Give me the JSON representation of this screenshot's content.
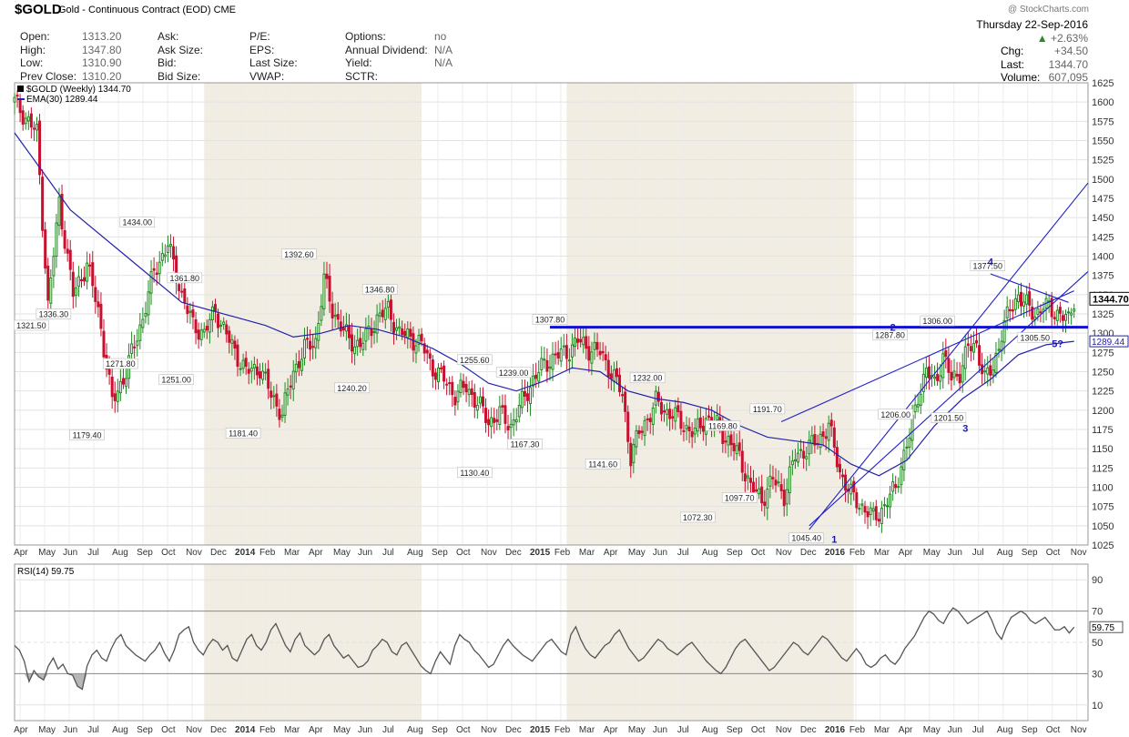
{
  "header": {
    "ticker": "$GOLD",
    "subtitle": "Gold - Continuous Contract (EOD)  CME",
    "credit": "@ StockCharts.com",
    "date": "Thursday  22-Sep-2016",
    "change_pct": "+2.63%",
    "chg_label": "Chg:",
    "chg_value": "+34.50",
    "last_label": "Last:",
    "last_value": "1344.70",
    "volume_label": "Volume:",
    "volume_value": "607,095"
  },
  "quote": {
    "col1": [
      {
        "label": "Open:",
        "value": "1313.20"
      },
      {
        "label": "High:",
        "value": "1347.80"
      },
      {
        "label": "Low:",
        "value": "1310.90"
      },
      {
        "label": "Prev Close:",
        "value": "1310.20"
      }
    ],
    "col2": [
      {
        "label": "Ask:",
        "value": ""
      },
      {
        "label": "Ask Size:",
        "value": ""
      },
      {
        "label": "Bid:",
        "value": ""
      },
      {
        "label": "Bid Size:",
        "value": ""
      }
    ],
    "col3": [
      {
        "label": "P/E:",
        "value": ""
      },
      {
        "label": "EPS:",
        "value": ""
      },
      {
        "label": "Last Size:",
        "value": ""
      },
      {
        "label": "VWAP:",
        "value": ""
      }
    ],
    "col4": [
      {
        "label": "Options:",
        "value": "no"
      },
      {
        "label": "Annual Dividend:",
        "value": "N/A"
      },
      {
        "label": "Yield:",
        "value": "N/A"
      },
      {
        "label": "SCTR:",
        "value": ""
      }
    ]
  },
  "chart_data": [
    {
      "type": "candlestick",
      "legend": [
        "$GOLD (Weekly) 1344.70",
        "EMA(30) 1289.44"
      ],
      "ylim": [
        1025,
        1625
      ],
      "y_ticks": [
        1025,
        1050,
        1075,
        1100,
        1125,
        1150,
        1175,
        1200,
        1225,
        1250,
        1275,
        1300,
        1325,
        1350,
        1375,
        1400,
        1425,
        1450,
        1475,
        1500,
        1525,
        1550,
        1575,
        1600,
        1625
      ],
      "x_labels": [
        "Apr",
        "May",
        "Jun",
        "Jul",
        "Aug",
        "Sep",
        "Oct",
        "Nov",
        "Dec",
        "2014",
        "Feb",
        "Mar",
        "Apr",
        "May",
        "Jun",
        "Jul",
        "Aug",
        "Sep",
        "Oct",
        "Nov",
        "Dec",
        "2015",
        "Feb",
        "Mar",
        "Apr",
        "May",
        "Jun",
        "Jul",
        "Aug",
        "Sep",
        "Oct",
        "Nov",
        "Dec",
        "2016",
        "Feb",
        "Mar",
        "Apr",
        "May",
        "Jun",
        "Jul",
        "Aug",
        "Sep",
        "Oct",
        "Nov"
      ],
      "price_path": [
        [
          0,
          1600
        ],
        [
          8,
          1560
        ],
        [
          12,
          1335
        ],
        [
          16,
          1470
        ],
        [
          21,
          1350
        ],
        [
          26,
          1390
        ],
        [
          30,
          1330
        ],
        [
          35,
          1210
        ],
        [
          40,
          1250
        ],
        [
          46,
          1320
        ],
        [
          50,
          1380
        ],
        [
          55,
          1415
        ],
        [
          60,
          1350
        ],
        [
          64,
          1310
        ],
        [
          68,
          1300
        ],
        [
          72,
          1330
        ],
        [
          77,
          1290
        ],
        [
          83,
          1250
        ],
        [
          88,
          1255
        ],
        [
          92,
          1220
        ],
        [
          96,
          1195
        ],
        [
          100,
          1250
        ],
        [
          104,
          1280
        ],
        [
          108,
          1290
        ],
        [
          111,
          1370
        ],
        [
          114,
          1330
        ],
        [
          117,
          1310
        ],
        [
          120,
          1290
        ],
        [
          124,
          1285
        ],
        [
          127,
          1300
        ],
        [
          130,
          1320
        ],
        [
          134,
          1330
        ],
        [
          138,
          1300
        ],
        [
          142,
          1295
        ],
        [
          146,
          1285
        ],
        [
          150,
          1255
        ],
        [
          154,
          1240
        ],
        [
          158,
          1220
        ],
        [
          162,
          1230
        ],
        [
          166,
          1210
        ],
        [
          170,
          1185
        ],
        [
          174,
          1195
        ],
        [
          178,
          1180
        ],
        [
          182,
          1210
        ],
        [
          186,
          1240
        ],
        [
          190,
          1260
        ],
        [
          194,
          1270
        ],
        [
          198,
          1275
        ],
        [
          202,
          1290
        ],
        [
          206,
          1280
        ],
        [
          210,
          1275
        ],
        [
          214,
          1250
        ],
        [
          218,
          1220
        ],
        [
          221,
          1140
        ],
        [
          224,
          1170
        ],
        [
          227,
          1190
        ],
        [
          230,
          1210
        ],
        [
          233,
          1200
        ],
        [
          236,
          1195
        ],
        [
          240,
          1180
        ],
        [
          244,
          1170
        ],
        [
          248,
          1190
        ],
        [
          252,
          1180
        ],
        [
          256,
          1160
        ],
        [
          260,
          1140
        ],
        [
          264,
          1100
        ],
        [
          268,
          1085
        ],
        [
          272,
          1110
        ],
        [
          276,
          1090
        ],
        [
          280,
          1140
        ],
        [
          284,
          1150
        ],
        [
          288,
          1160
        ],
        [
          292,
          1180
        ],
        [
          296,
          1120
        ],
        [
          300,
          1090
        ],
        [
          304,
          1075
        ],
        [
          308,
          1060
        ],
        [
          312,
          1075
        ],
        [
          316,
          1100
        ],
        [
          318,
          1130
        ],
        [
          321,
          1165
        ],
        [
          324,
          1220
        ],
        [
          327,
          1250
        ],
        [
          330,
          1235
        ],
        [
          333,
          1270
        ],
        [
          336,
          1240
        ],
        [
          339,
          1250
        ],
        [
          342,
          1280
        ],
        [
          345,
          1285
        ],
        [
          348,
          1240
        ],
        [
          351,
          1255
        ],
        [
          354,
          1300
        ],
        [
          357,
          1330
        ],
        [
          360,
          1350
        ],
        [
          363,
          1335
        ],
        [
          366,
          1325
        ],
        [
          369,
          1335
        ],
        [
          372,
          1330
        ],
        [
          375,
          1325
        ],
        [
          378,
          1315
        ],
        [
          380,
          1345
        ]
      ],
      "ema_path": [
        [
          0,
          1560
        ],
        [
          20,
          1460
        ],
        [
          40,
          1400
        ],
        [
          60,
          1340
        ],
        [
          80,
          1320
        ],
        [
          90,
          1310
        ],
        [
          100,
          1295
        ],
        [
          110,
          1300
        ],
        [
          120,
          1310
        ],
        [
          130,
          1305
        ],
        [
          140,
          1295
        ],
        [
          150,
          1280
        ],
        [
          160,
          1260
        ],
        [
          170,
          1235
        ],
        [
          180,
          1225
        ],
        [
          190,
          1238
        ],
        [
          200,
          1255
        ],
        [
          210,
          1250
        ],
        [
          220,
          1225
        ],
        [
          230,
          1215
        ],
        [
          240,
          1210
        ],
        [
          250,
          1200
        ],
        [
          260,
          1180
        ],
        [
          270,
          1165
        ],
        [
          280,
          1160
        ],
        [
          290,
          1155
        ],
        [
          300,
          1130
        ],
        [
          310,
          1115
        ],
        [
          320,
          1135
        ],
        [
          330,
          1180
        ],
        [
          340,
          1215
        ],
        [
          350,
          1240
        ],
        [
          360,
          1272
        ],
        [
          370,
          1285
        ],
        [
          380,
          1289.44
        ]
      ],
      "last_price": 1344.7,
      "ema_last": 1289.44,
      "horizontal_line": 1307.8,
      "price_labels": [
        {
          "text": "1321.50",
          "w": 6,
          "y": 1321.5,
          "pos": "below"
        },
        {
          "text": "1336.30",
          "w": 14,
          "y": 1336.3,
          "pos": "below"
        },
        {
          "text": "1179.40",
          "w": 26,
          "y": 1179.4,
          "pos": "below"
        },
        {
          "text": "1271.80",
          "w": 38,
          "y": 1271.8,
          "pos": "below"
        },
        {
          "text": "1434.00",
          "w": 44,
          "y": 1434,
          "pos": "above"
        },
        {
          "text": "1361.80",
          "w": 61,
          "y": 1361.8,
          "pos": "above"
        },
        {
          "text": "1251.00",
          "w": 58,
          "y": 1251,
          "pos": "below"
        },
        {
          "text": "1181.40",
          "w": 82,
          "y": 1181.4,
          "pos": "below"
        },
        {
          "text": "1392.60",
          "w": 102,
          "y": 1392.6,
          "pos": "above"
        },
        {
          "text": "1346.80",
          "w": 131,
          "y": 1346.8,
          "pos": "above"
        },
        {
          "text": "1240.20",
          "w": 121,
          "y": 1240.2,
          "pos": "below"
        },
        {
          "text": "1255.60",
          "w": 165,
          "y": 1255.6,
          "pos": "above"
        },
        {
          "text": "1239.00",
          "w": 179,
          "y": 1239,
          "pos": "above"
        },
        {
          "text": "1130.40",
          "w": 165,
          "y": 1130.4,
          "pos": "below"
        },
        {
          "text": "1167.30",
          "w": 183,
          "y": 1167.3,
          "pos": "below"
        },
        {
          "text": "1307.80",
          "w": 192,
          "y": 1307.8,
          "pos": "above"
        },
        {
          "text": "1141.60",
          "w": 211,
          "y": 1141.6,
          "pos": "below"
        },
        {
          "text": "1232.00",
          "w": 227,
          "y": 1232,
          "pos": "above"
        },
        {
          "text": "1169.80",
          "w": 254,
          "y": 1169.8,
          "pos": "above"
        },
        {
          "text": "1191.70",
          "w": 270,
          "y": 1191.7,
          "pos": "above"
        },
        {
          "text": "1072.30",
          "w": 245,
          "y": 1072.3,
          "pos": "below"
        },
        {
          "text": "1097.70",
          "w": 260,
          "y": 1097.7,
          "pos": "below"
        },
        {
          "text": "1045.40",
          "w": 284,
          "y": 1045.4,
          "pos": "below"
        },
        {
          "text": "1287.80",
          "w": 314,
          "y": 1287.8,
          "pos": "above"
        },
        {
          "text": "1306.00",
          "w": 331,
          "y": 1306,
          "pos": "above"
        },
        {
          "text": "1206.00",
          "w": 316,
          "y": 1206,
          "pos": "below"
        },
        {
          "text": "1201.50",
          "w": 335,
          "y": 1201.5,
          "pos": "below"
        },
        {
          "text": "1377.50",
          "w": 349,
          "y": 1377.5,
          "pos": "above"
        },
        {
          "text": "1305.50",
          "w": 366,
          "y": 1305.5,
          "pos": "below"
        }
      ],
      "wave_labels": [
        {
          "text": "1",
          "w": 293,
          "y": 1028
        },
        {
          "text": "2",
          "w": 314,
          "y": 1303
        },
        {
          "text": "3",
          "w": 340,
          "y": 1172
        },
        {
          "text": "4",
          "w": 349,
          "y": 1388
        },
        {
          "text": "5?",
          "w": 372,
          "y": 1282
        }
      ],
      "trend_lines": [
        [
          [
            285,
            1045
          ],
          [
            385,
            1495
          ]
        ],
        [
          [
            275,
            1185
          ],
          [
            380,
            1355
          ]
        ],
        [
          [
            285,
            1050
          ],
          [
            385,
            1380
          ]
        ],
        [
          [
            350,
            1377
          ],
          [
            378,
            1340
          ]
        ]
      ]
    },
    {
      "type": "line",
      "legend": [
        "RSI(14) 59.75"
      ],
      "ylim": [
        0,
        100
      ],
      "y_ticks": [
        10,
        30,
        50,
        70,
        90
      ],
      "last_value": 59.75,
      "x_labels": [
        "Apr",
        "May",
        "Jun",
        "Jul",
        "Aug",
        "Sep",
        "Oct",
        "Nov",
        "Dec",
        "2014",
        "Feb",
        "Mar",
        "Apr",
        "May",
        "Jun",
        "Jul",
        "Aug",
        "Sep",
        "Oct",
        "Nov",
        "Dec",
        "2015",
        "Feb",
        "Mar",
        "Apr",
        "May",
        "Jun",
        "Jul",
        "Aug",
        "Sep",
        "Oct",
        "Nov",
        "Dec",
        "2016",
        "Feb",
        "Mar",
        "Apr",
        "May",
        "Jun",
        "Jul",
        "Aug",
        "Sep",
        "Oct",
        "Nov"
      ],
      "values": [
        48,
        45,
        38,
        25,
        32,
        28,
        26,
        35,
        40,
        33,
        36,
        30,
        29,
        22,
        20,
        35,
        42,
        45,
        40,
        38,
        46,
        52,
        55,
        48,
        45,
        42,
        40,
        38,
        42,
        45,
        50,
        43,
        38,
        45,
        55,
        58,
        60,
        50,
        45,
        42,
        48,
        52,
        50,
        45,
        48,
        40,
        38,
        45,
        52,
        55,
        48,
        45,
        50,
        58,
        62,
        55,
        48,
        44,
        52,
        56,
        48,
        45,
        42,
        45,
        52,
        55,
        48,
        44,
        40,
        42,
        38,
        34,
        35,
        38,
        45,
        48,
        52,
        50,
        44,
        42,
        48,
        50,
        45,
        40,
        35,
        32,
        30,
        38,
        44,
        40,
        36,
        48,
        55,
        52,
        50,
        45,
        42,
        38,
        34,
        36,
        42,
        48,
        52,
        48,
        45,
        42,
        40,
        38,
        42,
        46,
        50,
        52,
        48,
        44,
        42,
        55,
        60,
        52,
        46,
        42,
        40,
        44,
        48,
        50,
        55,
        58,
        52,
        46,
        42,
        38,
        40,
        44,
        48,
        52,
        50,
        46,
        44,
        42,
        45,
        48,
        50,
        46,
        42,
        38,
        35,
        32,
        30,
        34,
        40,
        46,
        50,
        52,
        48,
        44,
        40,
        36,
        32,
        34,
        38,
        42,
        46,
        50,
        48,
        44,
        42,
        46,
        50,
        54,
        52,
        48,
        44,
        40,
        38,
        42,
        46,
        42,
        36,
        34,
        36,
        40,
        42,
        38,
        36,
        40,
        46,
        50,
        54,
        60,
        66,
        70,
        68,
        64,
        62,
        68,
        72,
        70,
        66,
        62,
        64,
        66,
        68,
        70,
        64,
        56,
        52,
        60,
        66,
        68,
        70,
        68,
        64,
        62,
        64,
        66,
        62,
        58,
        58,
        60,
        56,
        59.75
      ]
    }
  ]
}
